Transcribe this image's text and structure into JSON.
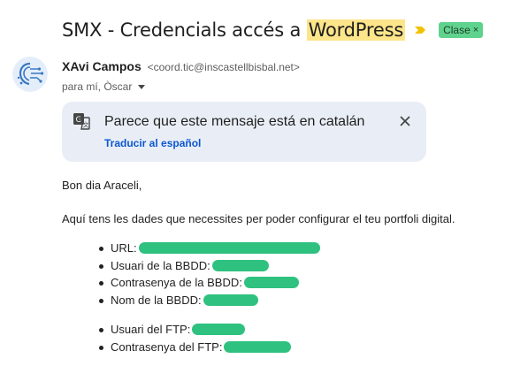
{
  "subject": {
    "text_before": "SMX - Credencials accés a ",
    "highlight": "WordPress",
    "importance_icon": "importance-marker",
    "label": "Clase",
    "label_remove": "×",
    "colors": {
      "highlight": "#fde58a",
      "label_bg": "#5fd38d",
      "importance": "#f2c200"
    }
  },
  "sender": {
    "name": "XAvi Campos",
    "email": "<coord.tic@inscastellbisbal.net>",
    "recipients": "para mí, Òscar"
  },
  "translation": {
    "message": "Parece que este mensaje está en catalán",
    "link": "Traducir al español",
    "icon": "translate-icon",
    "close_icon": "close-icon",
    "colors": {
      "background": "#e9eef6",
      "link": "#0b57d0"
    }
  },
  "body": {
    "greeting": "Bon dia Araceli,",
    "intro": "Aquí tens les dades que necessites per poder configurar el teu portfoli digital.",
    "list_db": [
      {
        "label": "URL:"
      },
      {
        "label": "Usuari de la BBDD:"
      },
      {
        "label": "Contrasenya de la BBDD:"
      },
      {
        "label": "Nom de la BBDD:"
      }
    ],
    "list_ftp": [
      {
        "label": "Usuari del FTP:"
      },
      {
        "label": "Contrasenya del FTP:"
      }
    ],
    "redaction_color": "#2fc17f"
  }
}
